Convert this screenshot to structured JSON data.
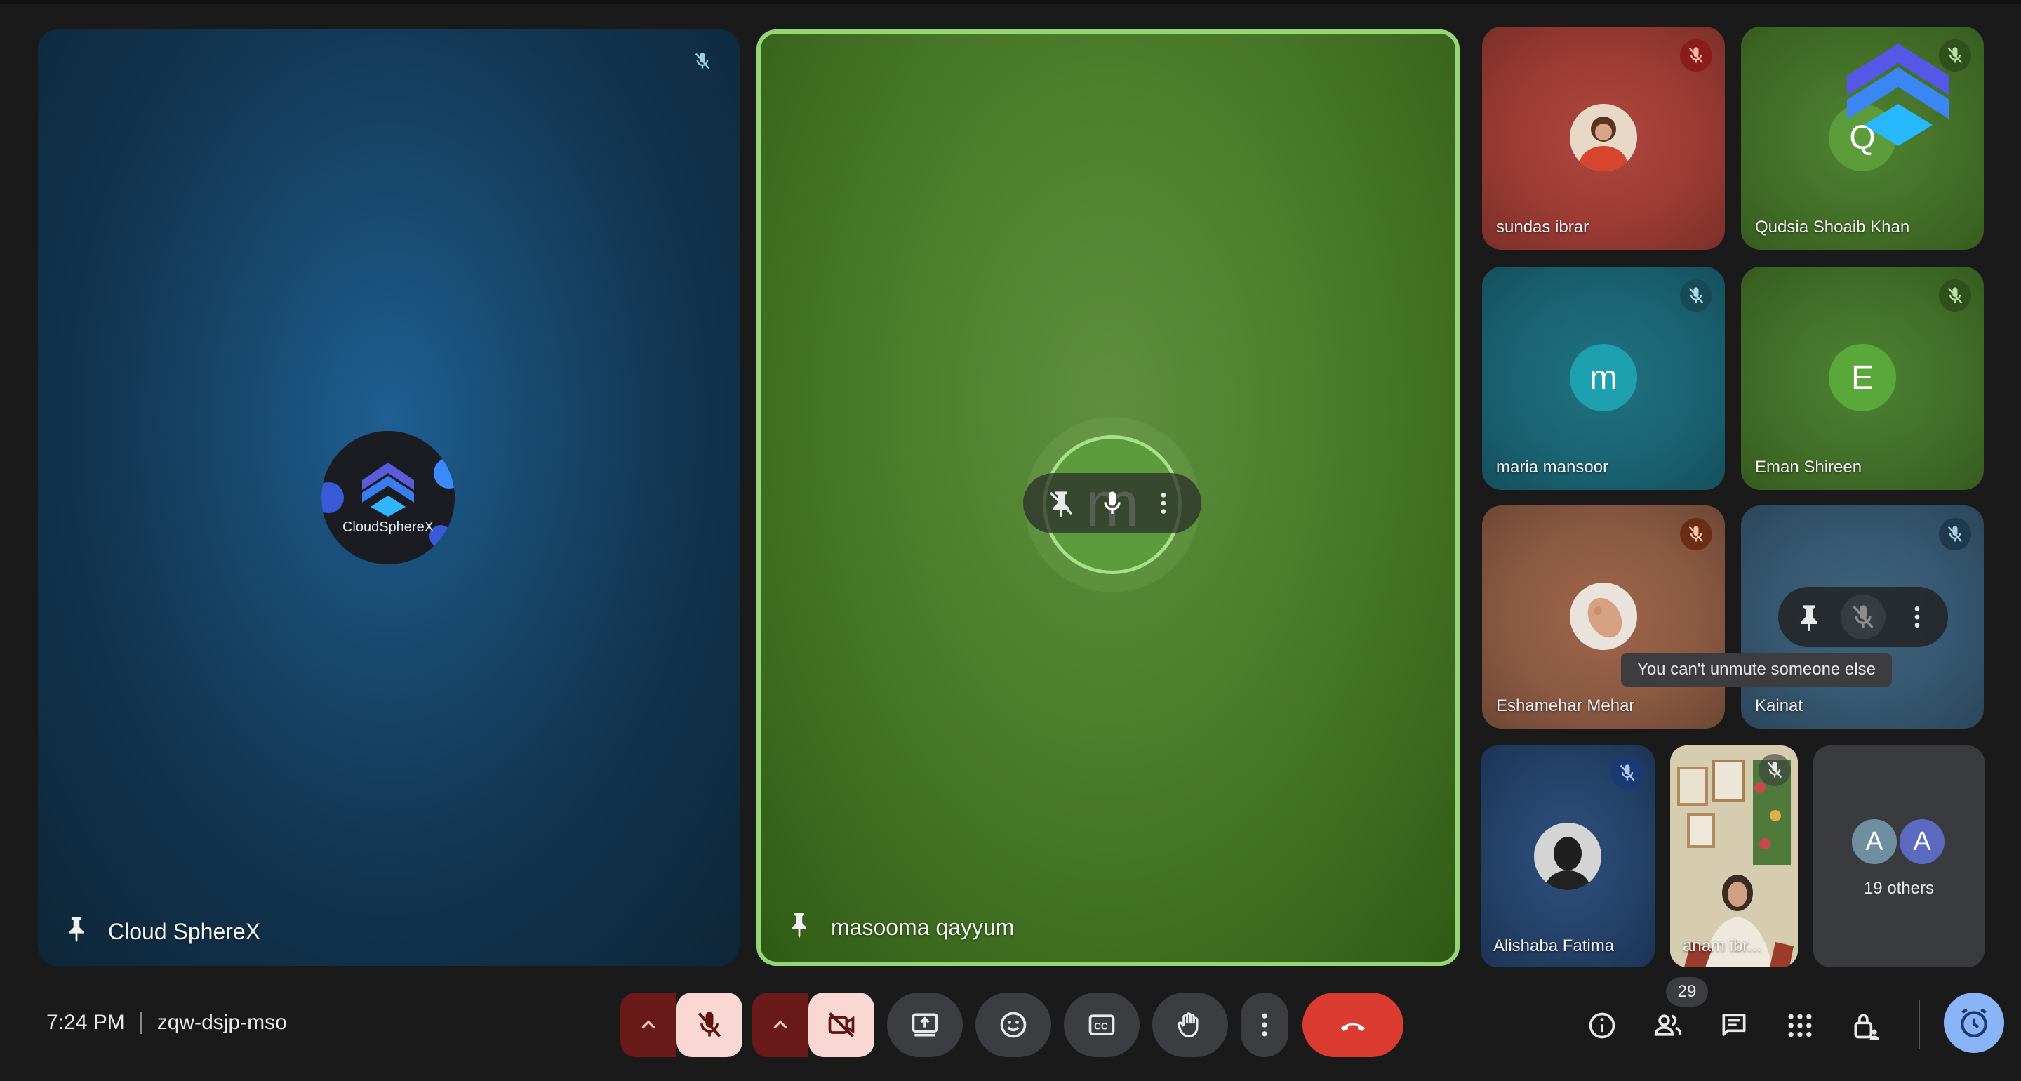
{
  "meeting": {
    "time": "7:24 PM",
    "code": "zqw-dsjp-mso"
  },
  "main_tiles": {
    "cloud": {
      "name": "Cloud SphereX",
      "logo_text": "CloudSphereX"
    },
    "masooma": {
      "name": "masooma qayyum",
      "avatar_letter": "m"
    }
  },
  "participants": [
    {
      "name": "sundas ibrar"
    },
    {
      "name": "Qudsia Shoaib Khan",
      "avatar_letter": "Q"
    },
    {
      "name": "maria mansoor",
      "avatar_letter": "m"
    },
    {
      "name": "Eman Shireen",
      "avatar_letter": "E"
    },
    {
      "name": "Eshamehar Mehar"
    },
    {
      "name": "Kainat"
    },
    {
      "name": "Alishaba Fatima"
    },
    {
      "name": "anam ibr..."
    }
  ],
  "others": {
    "label": "19 others",
    "avatars": [
      "A",
      "A"
    ]
  },
  "tooltip": "You can't unmute someone else",
  "people_count": "29",
  "colors": {
    "speaking_border": "#96d678",
    "hangup": "#dc3b31",
    "mic_off_bg": "#f9d8d4",
    "profile": "#8ab4f8"
  },
  "icons": {
    "mic_toggle": "mic-off-icon",
    "camera_toggle": "camera-off-icon",
    "present": "present-screen-icon",
    "reactions": "emoji-icon",
    "captions": "captions-icon",
    "raise_hand": "raise-hand-icon",
    "more": "more-vert-icon",
    "leave": "call-end-icon",
    "info": "info-icon",
    "people": "people-icon",
    "chat": "chat-icon",
    "activities": "apps-grid-icon",
    "host_controls": "lock-person-icon",
    "profile": "timer-icon"
  }
}
